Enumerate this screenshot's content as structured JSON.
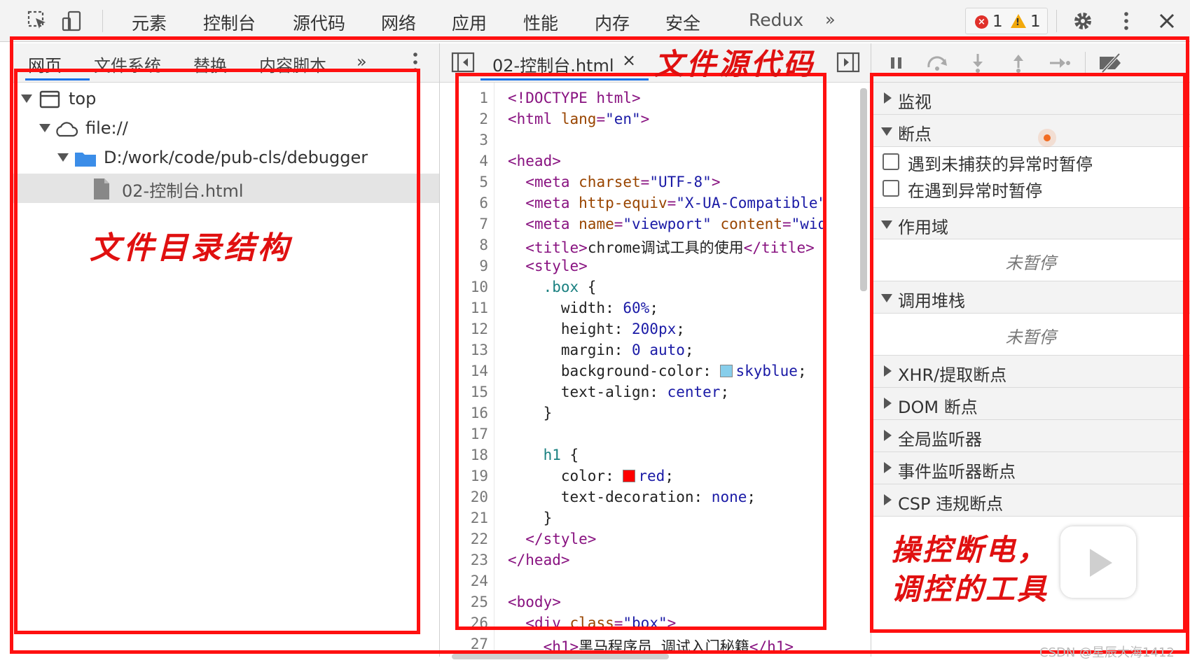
{
  "toolbar": {
    "tabs": [
      "元素",
      "控制台",
      "源代码",
      "网络",
      "应用",
      "性能",
      "内存",
      "安全",
      "Redux"
    ],
    "more_tabs_icon": "»",
    "error_count": "1",
    "warning_count": "1",
    "icons": [
      "inspect-element-icon",
      "device-toolbar-icon",
      "settings-gear-icon",
      "more-vert-icon",
      "close-icon"
    ]
  },
  "left_panel": {
    "tabs": [
      "网页",
      "文件系统",
      "替换",
      "内容脚本"
    ],
    "more_tabs_icon": "»",
    "tree": [
      {
        "label": "top",
        "icon": "frame-icon",
        "expanded": true
      },
      {
        "label": "file://",
        "icon": "cloud-icon",
        "expanded": true
      },
      {
        "label": "D:/work/code/pub-cls/debugger",
        "icon": "folder-icon",
        "expanded": true
      },
      {
        "label": "02-控制台.html",
        "icon": "file-icon",
        "selected": true
      }
    ]
  },
  "editor": {
    "file_tab": "02-控制台.html",
    "close_icon": "×",
    "line_numbers": [
      "1",
      "2",
      "3",
      "4",
      "5",
      "6",
      "7",
      "8",
      "9",
      "10",
      "11",
      "12",
      "13",
      "14",
      "15",
      "16",
      "17",
      "18",
      "19",
      "20",
      "21",
      "22",
      "23",
      "24",
      "25",
      "26",
      "27"
    ],
    "swatch_colors": {
      "skyblue": "#87ceeb",
      "red": "#ff0000"
    }
  },
  "debugger": {
    "sections": {
      "watch": "监视",
      "breakpoints": "断点",
      "scope": "作用域",
      "call_stack": "调用堆栈",
      "xhr": "XHR/提取断点",
      "dom": "DOM 断点",
      "global_listeners": "全局监听器",
      "event_listeners": "事件监听器断点",
      "csp": "CSP 违规断点"
    },
    "checkboxes": [
      "遇到未捕获的异常时暂停",
      "在遇到异常时暂停"
    ],
    "not_paused": "未暂停"
  },
  "annotations": {
    "file_tree": "文件目录结构",
    "source_code": "文件源代码",
    "debug_tools_line1": "操控断电，",
    "debug_tools_line2": "调控的工具",
    "color": "#ff1010"
  },
  "watermark": "CSDN @星辰大海1412"
}
